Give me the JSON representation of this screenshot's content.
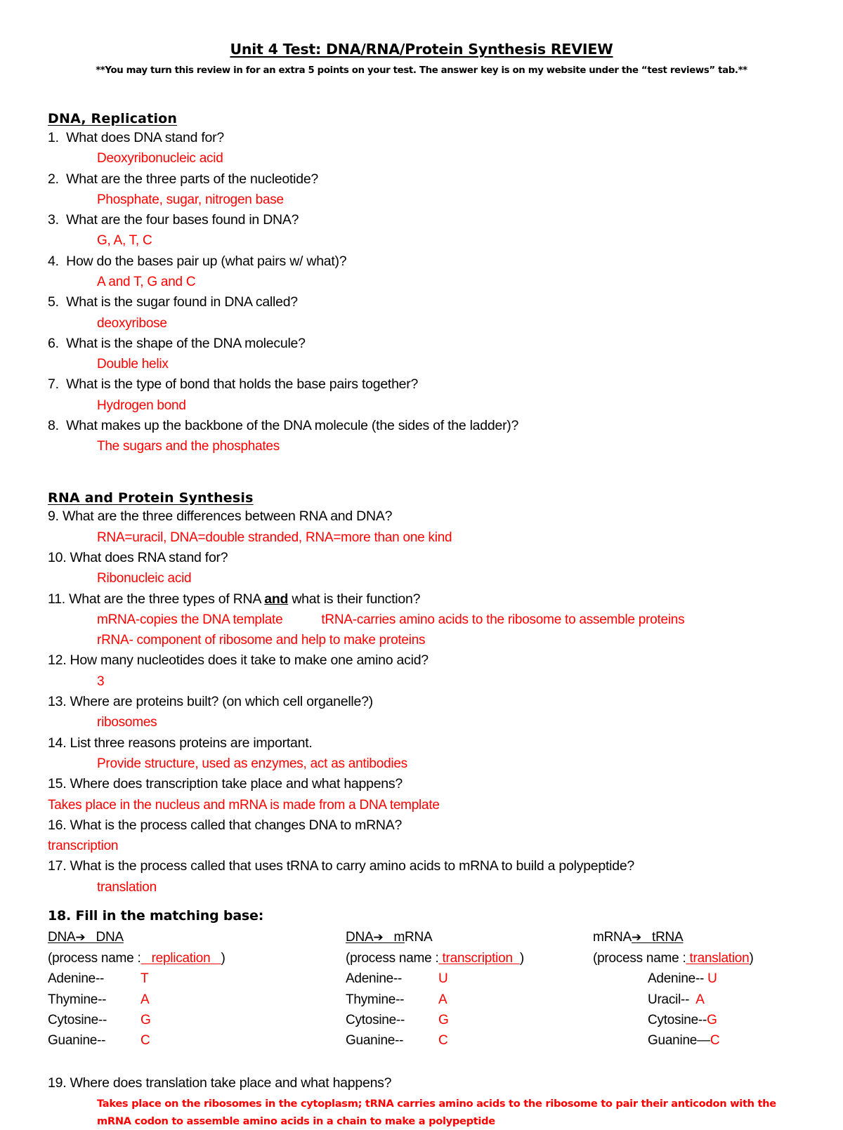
{
  "document": {
    "title": "Unit 4 Test: DNA/RNA/Protein Synthesis REVIEW",
    "subtitle": "**You may turn this review in for an extra 5 points on your test.  The answer key is on my website under the “test reviews” tab.**",
    "answer_color": "#FF0000",
    "text_color": "#000000"
  },
  "sections": [
    {
      "heading": "DNA, Replication",
      "items": [
        {
          "number": "1.",
          "question": "What does DNA stand for?",
          "answer": "Deoxyribonucleic acid"
        },
        {
          "number": "2.",
          "question": "What are the three parts of the nucleotide?",
          "answer": "Phosphate, sugar, nitrogen base"
        },
        {
          "number": "3.",
          "question": "What are the four bases found in DNA?",
          "answer": "G, A, T, C"
        },
        {
          "number": "4.",
          "question": "How do the bases pair up (what pairs w/ what)?",
          "answer": "A and T,  G and C"
        },
        {
          "number": "5.",
          "question": "What is the sugar found in DNA called?",
          "answer": "deoxyribose"
        },
        {
          "number": "6.",
          "question": "What is the shape of the DNA molecule?",
          "answer": "Double helix"
        },
        {
          "number": "7.",
          "question": "What is the type of bond that holds the base pairs together?",
          "answer": "Hydrogen bond"
        },
        {
          "number": "8.",
          "question": "What makes up the backbone of the DNA molecule (the sides of the ladder)?",
          "answer": "The sugars and the phosphates"
        }
      ]
    },
    {
      "heading": "RNA and Protein Synthesis",
      "items": [
        {
          "number": "9.",
          "question": "What are the three differences between RNA and DNA?",
          "answer": "RNA=uracil, DNA=double stranded, RNA=more than one kind"
        },
        {
          "number": "10.",
          "question": "What does RNA stand for?",
          "answer": "Ribonucleic acid"
        },
        {
          "number": "11.",
          "question_before": "What are the three types of RNA ",
          "question_emphasis": "and",
          "question_after": " what is their function?",
          "answer_line_1_a": "mRNA-copies the DNA template",
          "answer_line_1_b": "tRNA-carries amino acids to the ribosome to assemble proteins",
          "answer_line_2": "rRNA- component of ribosome and help to make proteins"
        },
        {
          "number": "12.",
          "question": "How many nucleotides does it take to make one amino acid?",
          "answer": "3"
        },
        {
          "number": "13.",
          "question": "Where are proteins built? (on which cell organelle?)",
          "answer": "ribosomes"
        },
        {
          "number": "14.",
          "question": "List three reasons proteins are important.",
          "answer": "Provide structure, used as enzymes, act as antibodies"
        },
        {
          "number": "15.",
          "question": "Where does transcription take place and what happens?",
          "answer": "Takes place in the nucleus and mRNA is made from a DNA template",
          "answer_flush": true
        },
        {
          "number": "16.",
          "question": "What is the process called that changes DNA to mRNA?",
          "answer": "transcription",
          "answer_flush": true
        },
        {
          "number": "17.",
          "question": "What is the process called that uses tRNA to carry amino acids to mRNA to build a polypeptide?",
          "answer": "translation"
        }
      ]
    }
  ],
  "question18": {
    "heading": "18. Fill in the matching base:",
    "columns": [
      {
        "header_left": "DNA",
        "header_arrow": "➔",
        "header_right": "DNA",
        "process_label": "(process name :",
        "process_value": "replication",
        "process_close": ")",
        "rows": [
          {
            "label": "Adenine--",
            "value": "T"
          },
          {
            "label": "Thymine--",
            "value": "A"
          },
          {
            "label": "Cytosine--",
            "value": "G"
          },
          {
            "label": "Guanine--",
            "value": "C"
          }
        ]
      },
      {
        "header_left": "DNA",
        "header_arrow": "➔",
        "header_right_fill": "m",
        "header_right_rest": "RNA",
        "process_label": "(process name :",
        "process_value": "transcription",
        "process_close": ")",
        "rows": [
          {
            "label": "Adenine--",
            "value": "U"
          },
          {
            "label": "Thymine--",
            "value": "A"
          },
          {
            "label": "Cytosine--",
            "value": "G"
          },
          {
            "label": "Guanine--",
            "value": "C"
          }
        ]
      },
      {
        "header_left": "mRNA",
        "header_arrow": "➔",
        "header_right": "tRNA",
        "process_label": "(process name :",
        "process_value": "translation",
        "process_close": ")",
        "rows": [
          {
            "label": "Adenine--",
            "value": "U"
          },
          {
            "label": "Uracil--",
            "value": "A"
          },
          {
            "label": "Cytosine--",
            "value": "G"
          },
          {
            "label": "Guanine—",
            "value": "C"
          }
        ]
      }
    ]
  },
  "question19": {
    "number": "19.",
    "question": "Where does translation take place and what happens?",
    "answer_line_1": "Takes place on the ribosomes in the cytoplasm; tRNA carries amino acids to the ribosome to pair their anticodon with the",
    "answer_line_2": "mRNA codon to assemble amino acids in a chain to make a polypeptide"
  }
}
